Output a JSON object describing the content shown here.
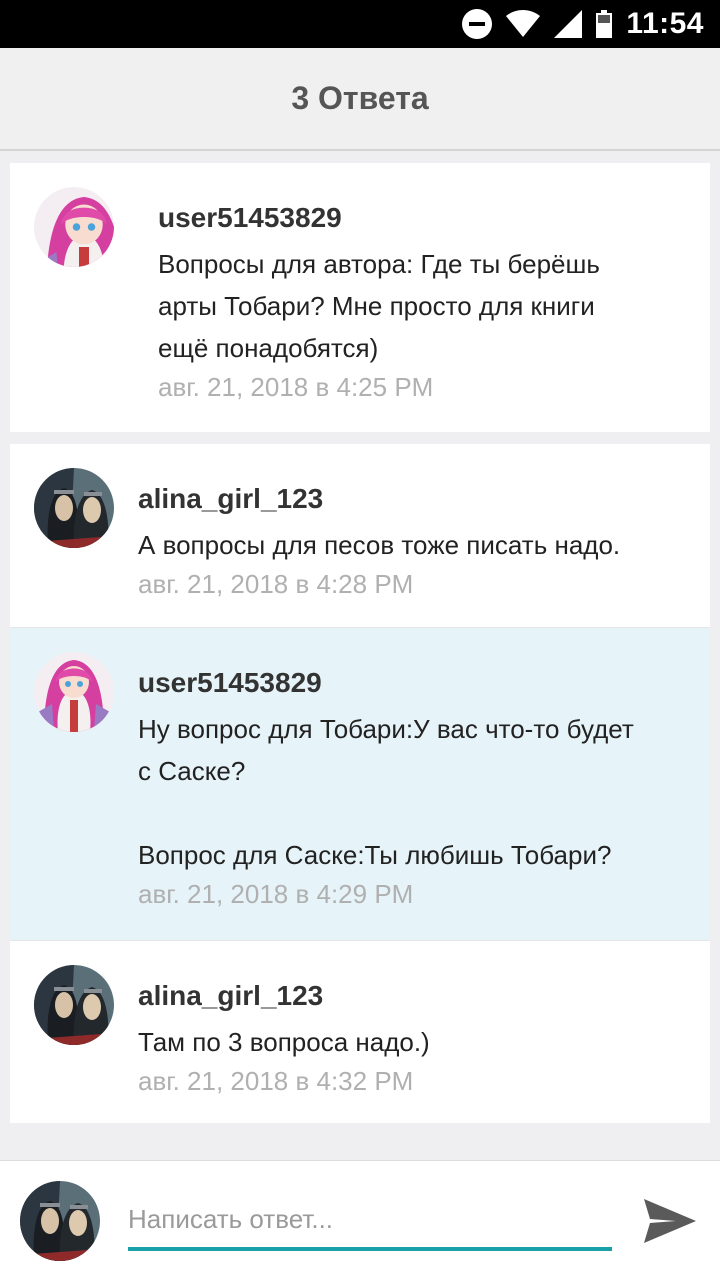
{
  "status_bar": {
    "time": "11:54",
    "icons": [
      "do-not-disturb-icon",
      "wifi-icon",
      "signal-icon",
      "battery-icon"
    ]
  },
  "header": {
    "title": "3 Ответа"
  },
  "comments": [
    {
      "author": "user51453829",
      "text": "Вопросы для автора: Где ты берёшь\nарты Тобари? Мне просто для книги\nещё понадобятся)",
      "time": "авг. 21, 2018 в 4:25 PM",
      "avatar": "pink-hair-anime-avatar"
    },
    {
      "author": "alina_girl_123",
      "text": "А вопросы для песов тоже писать надо.",
      "time": "авг. 21, 2018 в 4:28 PM",
      "avatar": "dark-hair-anime-avatar"
    },
    {
      "author": "user51453829",
      "text": "Ну вопрос для Тобари:У вас что-то будет\nс Саске?\n\nВопрос для Саске:Ты любишь Тобари?",
      "time": "авг. 21, 2018 в 4:29 PM",
      "avatar": "pink-hair-anime-avatar",
      "highlighted": true
    },
    {
      "author": "alina_girl_123",
      "text": "Там по 3 вопроса надо.)",
      "time": "авг. 21, 2018 в 4:32 PM",
      "avatar": "dark-hair-anime-avatar"
    }
  ],
  "composer": {
    "placeholder": "Написать ответ...",
    "avatar": "dark-hair-anime-avatar",
    "send_icon": "send-icon"
  },
  "colors": {
    "accent": "#1aa1a8",
    "highlight_bg": "#e6f3f8",
    "timestamp": "#b0b0b0"
  }
}
